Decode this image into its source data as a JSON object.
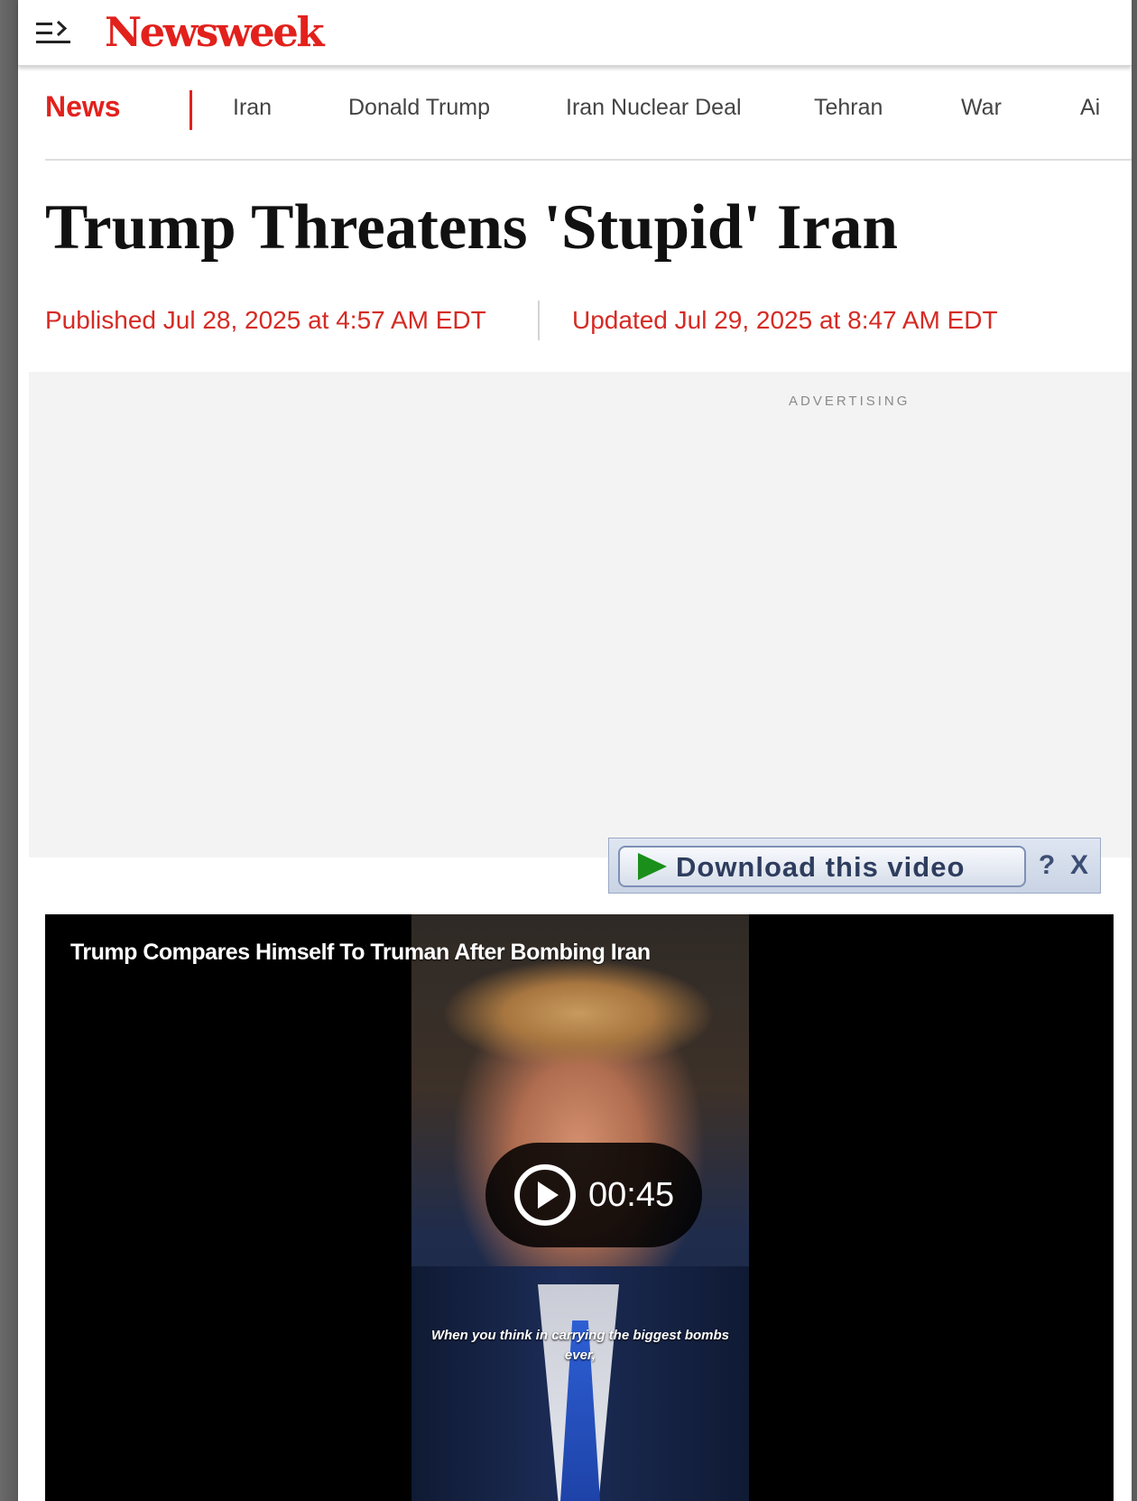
{
  "brand": {
    "logo_text": "Newsweek",
    "accent_color": "#e2211c"
  },
  "header": {
    "menu_icon": "menu-arrow-icon"
  },
  "nav": {
    "section": "News",
    "items": [
      {
        "label": "Iran"
      },
      {
        "label": "Donald Trump"
      },
      {
        "label": "Iran Nuclear Deal"
      },
      {
        "label": "Tehran"
      },
      {
        "label": "War"
      },
      {
        "label": "Ai"
      }
    ]
  },
  "article": {
    "headline": "Trump Threatens 'Stupid' Iran",
    "published": "Published Jul 28, 2025 at 4:57 AM EDT",
    "updated": "Updated Jul 29, 2025 at 8:47 AM EDT"
  },
  "ad": {
    "label": "ADVERTISING"
  },
  "download_bar": {
    "button_label": "Download this video",
    "help_label": "?",
    "close_label": "X",
    "play_icon": "green-play-icon"
  },
  "video": {
    "title": "Trump Compares Himself To Truman After Bombing Iran",
    "duration": "00:45",
    "caption": "When you think in carrying the biggest bombs ever,",
    "play_icon": "play-circle-icon"
  }
}
